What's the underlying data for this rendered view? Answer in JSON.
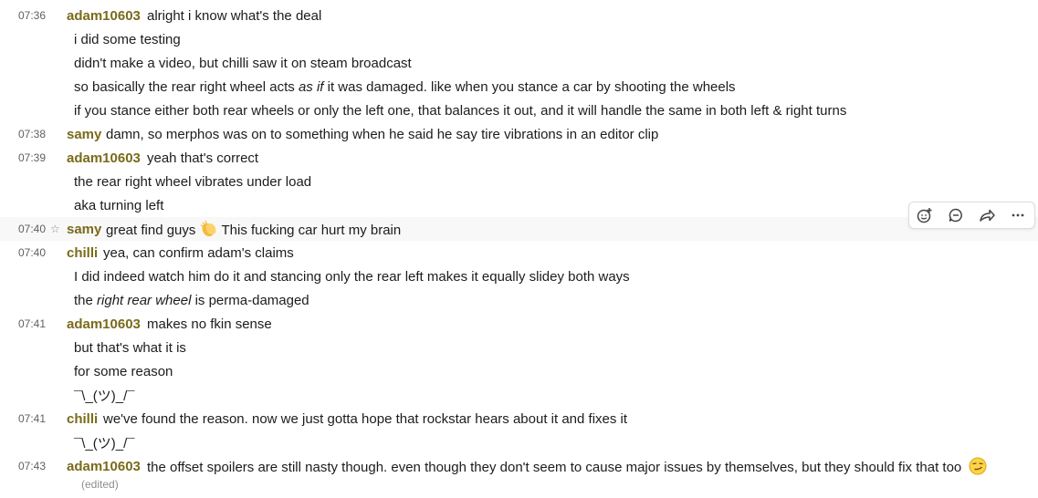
{
  "messages": [
    {
      "time": "07:36",
      "author": "adam10603",
      "text": "alright i know what's the deal"
    },
    {
      "text": "i did some testing"
    },
    {
      "text": "didn't make a video, but chilli saw it on steam broadcast"
    },
    {
      "text_before": "so basically the rear right wheel acts ",
      "text_em": "as if",
      "text_after": " it was damaged. like when you stance a car by shooting the wheels"
    },
    {
      "text": "if you stance either both rear wheels or only the left one, that balances it out, and it will handle the same in both left & right turns"
    },
    {
      "time": "07:38",
      "author": "samy",
      "text": "damn, so merphos was on to something when he said he say tire vibrations in an editor clip"
    },
    {
      "time": "07:39",
      "author": "adam10603",
      "text": "yeah that's correct"
    },
    {
      "text": "the rear right wheel vibrates under load"
    },
    {
      "text": "aka turning left"
    },
    {
      "time": "07:40",
      "author": "samy",
      "text_before": "great find guys",
      "text_after": "This fucking car hurt my brain",
      "emoji": "clapping-hands"
    },
    {
      "time": "07:40",
      "author": "chilli",
      "text": "yea, can confirm adam's claims"
    },
    {
      "text": "I did indeed watch him do it and stancing only the rear left makes it equally slidey both ways"
    },
    {
      "text_before": "the ",
      "text_em": "right rear wheel",
      "text_after": " is perma-damaged"
    },
    {
      "time": "07:41",
      "author": "adam10603",
      "text": "makes no fkin sense"
    },
    {
      "text": "but that's what it is"
    },
    {
      "text": "for some reason"
    },
    {
      "text": "¯\\_(ツ)_/¯"
    },
    {
      "time": "07:41",
      "author": "chilli",
      "text": "we've found the reason. now we just gotta hope that rockstar hears about it and fixes it"
    },
    {
      "text": "¯\\_(ツ)_/¯"
    },
    {
      "time": "07:43",
      "author": "adam10603",
      "text": "the offset spoilers are still nasty though. even though they don't seem to cause major issues by themselves, but they should fix that too",
      "emoji": "smirk-face",
      "edited": "(edited)"
    }
  ],
  "hover_actions": [
    "add-reaction-icon",
    "reply-in-thread-icon",
    "share-icon",
    "more-actions-icon"
  ],
  "colors": {
    "author": "#7a6a1a",
    "timestamp": "#616061",
    "hover_bg": "#f8f8f8"
  }
}
